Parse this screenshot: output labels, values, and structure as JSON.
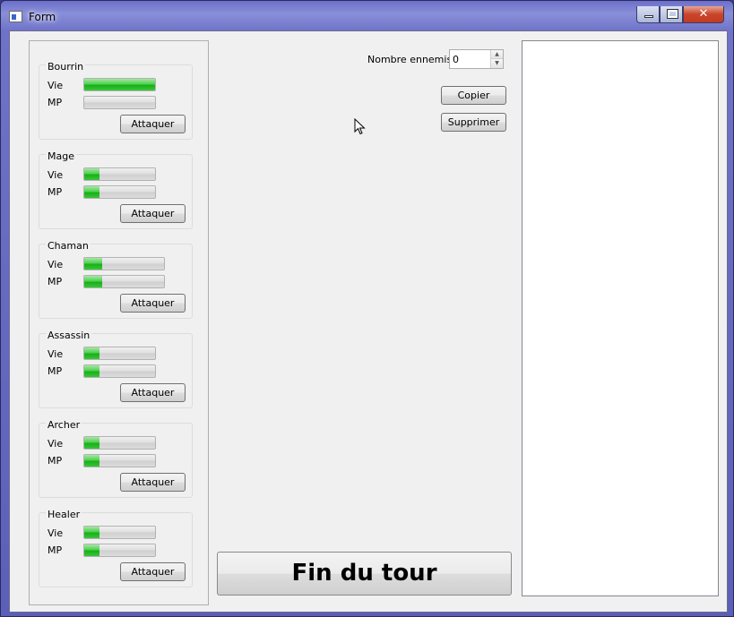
{
  "window": {
    "title": "Form",
    "close_glyph": "✕"
  },
  "characters": [
    {
      "name": "Bourrin",
      "vie_label": "Vie",
      "mp_label": "MP",
      "vie": 1.0,
      "mp": 0.0,
      "attack_label": "Attaquer"
    },
    {
      "name": "Mage",
      "vie_label": "Vie",
      "mp_label": "MP",
      "vie": 0.22,
      "mp": 0.22,
      "attack_label": "Attaquer"
    },
    {
      "name": "Chaman",
      "vie_label": "Vie",
      "mp_label": "MP",
      "vie": 0.22,
      "mp": 0.22,
      "attack_label": "Attaquer"
    },
    {
      "name": "Assassin",
      "vie_label": "Vie",
      "mp_label": "MP",
      "vie": 0.22,
      "mp": 0.22,
      "attack_label": "Attaquer"
    },
    {
      "name": "Archer",
      "vie_label": "Vie",
      "mp_label": "MP",
      "vie": 0.22,
      "mp": 0.22,
      "attack_label": "Attaquer"
    },
    {
      "name": "Healer",
      "vie_label": "Vie",
      "mp_label": "MP",
      "vie": 0.22,
      "mp": 0.22,
      "attack_label": "Attaquer"
    }
  ],
  "enemies": {
    "label": "Nombre ennemis :",
    "value": "0"
  },
  "actions": {
    "copy_label": "Copier",
    "delete_label": "Supprimer",
    "end_turn_label": "Fin du tour"
  },
  "icons": {
    "app": "form-app-icon",
    "minimize": "minimize-icon",
    "maximize": "maximize-icon",
    "close": "close-icon",
    "cursor": "mouse-cursor-icon"
  }
}
